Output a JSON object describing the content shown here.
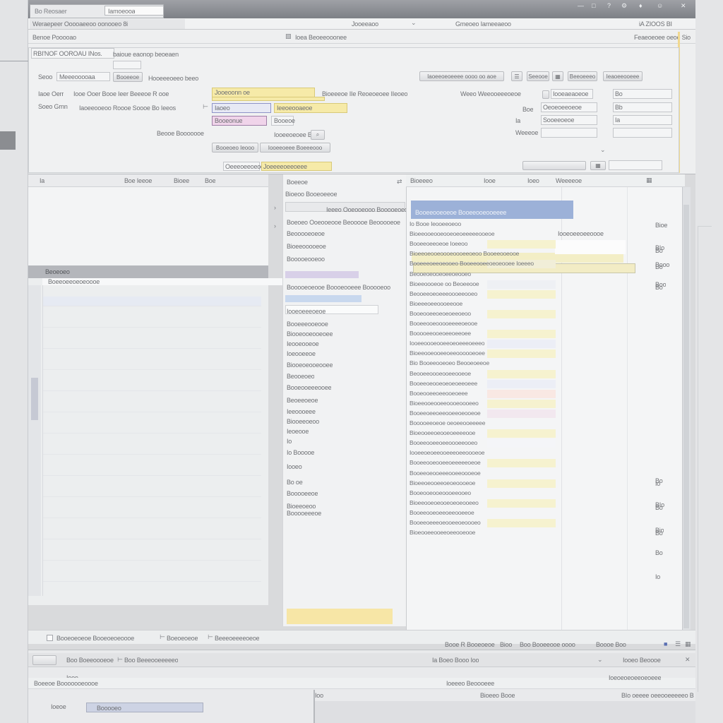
{
  "title": {
    "tab_label": "Bo Reosaer",
    "tab_selected": "Iamoeooa"
  },
  "menubar": {
    "path": "Weraepeer Ooooaeeoo oonooeo 8i",
    "center": "Jooeeaoo",
    "mid_right": "Gmeoeo Iameeaeoo",
    "icons": "iA ZIOOS BI"
  },
  "search": {
    "header_left": "Benoe Pooooao",
    "header_center": "Ioea Beoeeooonee",
    "header_right": "Feaeoeoee oeoe Sio",
    "subheader": "RBI'NOF OOROAU INos.",
    "subheader2": "baioue eaonop beoeaen",
    "row1_label": "Seoo",
    "row1_field": "Meeeooooaa",
    "row1_btn": "Booeeoe",
    "row1_text": "Hooeeeoeeo beeo",
    "row1_right": "Iaoeeoeoeeee oooo oo aoe",
    "row1_btn2": "Seeooe",
    "row1_btn3": "Beeoeeeo",
    "row1_btn4": "Ieaoeeooeee",
    "f1_label": "Iaoe Oerr",
    "f1_text": "Iooe Ooer Booe Ieer Beeeoe R ooe",
    "f1_value": "Jooeoonn oe",
    "f1_right": "Bioeeeoe IIe Reoeoeoee IIeoeo",
    "f1_right2": "Weeo Weeooeeeoeoe",
    "f2_label": "Soeo Grnn",
    "f2_text": "Iaoeeooeoo Roooe Soooe Bo Ieeos",
    "f2_value": "Iaoeo",
    "f2_value2": "Ieeoeooaeoe",
    "f2_right": "Booeeoeoe",
    "f3_value": "Booeonue",
    "f3_value2": "Booeoe",
    "f3_left": "Beooe Booooooe",
    "f4_text": "Iooeeoeoee Bio",
    "f4_btn": "Booeoeo Ieooo",
    "f5_btn": "Iooeeoeee Boeeeooo",
    "right_labels": [
      "Ia",
      "Boe",
      "Weeeoe"
    ],
    "right_values": [
      "Iooeaeaoeoe",
      "Oeoeoeeoeoe",
      "Sooeeoeoe"
    ],
    "right_badges": [
      "Bo",
      "Bb",
      "Ia"
    ],
    "footer_field": "Oeeeoeeoeooeo",
    "footer_field2": "Joeeeeoeeoeee"
  },
  "left_panel": {
    "header": [
      "Ia",
      "Boe Ieeoe",
      "Bioee",
      "Boe"
    ],
    "bar_label": "Beoeoeo",
    "row_label": "Boeeoeeoeoeoooe"
  },
  "mid_panel": {
    "header": "Bioeoo Booeoeeoe",
    "items": [
      "Ieeeo  Ooeooeooo Booooeoeoe Ia",
      "Boeoeo Ooeooeooe Beooooe Beooooeoe",
      "Beooooeoeoe",
      "Bioeeooooeoe",
      "Booooeooeoo",
      "Booooeoeooe  Boooeooeee  Booooeoo",
      "Iooeoeeeoeoe",
      "Booeeeooeooe",
      "Biooeooeooeoee",
      "Ieooeooeoe",
      "Ioeooeeoe",
      "Biooeoeooeooee",
      "Beooeoeo",
      "Booeooeeeooee",
      "Beoeeoeoe",
      "Ieeoooeee",
      "Biooeeoeoo",
      "Ieoeooe",
      "Io",
      "Io  Booooe",
      "Iooeo",
      "Bo oe",
      "Booooeeoe",
      "Bioeeoeoo",
      "Booooeeeoe"
    ]
  },
  "right_panel": {
    "header": [
      "Bioeeeo",
      "Iooe",
      "Ioeo",
      "Weeeeoe"
    ],
    "selected": "Booeeooeoeoe  Booeeooeooeeee",
    "rows": [
      "Io Booe Ieooeeoeoo",
      "Bioeeooeooeooeoeoeeeeeooeoe",
      "Booeeoeeoeoe  Ioeeoo",
      "Bioeeoeooeoooeoooeeoeoo Booeeooeooe",
      "Booeeeoeeoeooeo Booeeooeeoeoeooee Ioeeeo",
      "Beooeoeooeoeeoeooeo",
      "Bioeeoooeoe oo Beoeeooe",
      "Beooeeoeoeeeoooeeooeo",
      "Bioeeeoeeoooeeooe",
      "Booeooeeoeoeoeeoeoo",
      "Booeeooeooooeeeeoeooe",
      "Booooeeooeoeeoeeoee",
      "Iooeeoooeooeeoeoeeeoeeeo",
      "Bioeeooeooeeoeeoooooeoee",
      "Bio Booeeooeoeo Beooeoeeoe",
      "Beooeeoooeooeeooeoe",
      "Booeeoeooeoeoeoeeoeee",
      "Booeooeeoeeooeoeee",
      "Bioeeooeooeeoooeoooeeo",
      "Booeeoeeoeeooeeoeooeoe",
      "Booooeeoeoe oeoeeooeeeee",
      "Bioeooeeoeooeoeeeeooe",
      "Booeeooeeoeeoooeeooeo",
      "Iooeeoeoeeooeeeoeeoooeoe",
      "Booeeooeooeeoeeeeeoeoe",
      "Booeeoeooeeeooeeoooeoe",
      "Bioeeoeooeeoeoeoooeoe",
      "Booeooeooeoooeeooeo",
      "Bioeeooeoeooeoeoeooeeo",
      "Booeeooeoeeoeeooeeoe",
      "Booeeoeeeoeooeeoeoooeo",
      "Bioeooeeooeeoeeooeooe"
    ],
    "right_col": [
      "Iooeoeeoeeoooe",
      "Bo",
      "Bo",
      "Bo",
      "Io",
      "Bo",
      "Bo",
      "Io"
    ],
    "far_col": [
      "Bioe",
      "BIo",
      "Booo",
      "Boo",
      "Bo",
      "BIo",
      "Bio",
      "Bo"
    ]
  },
  "status": {
    "left": "Booeoeoeoe Booeoeoeoooe",
    "mid": "Boeoeoeoe",
    "mid2": "Beeeoeeeeoeoe",
    "right": "Booe R Booeoeoe",
    "right2": "Bioo",
    "right3": "Boo Booeeooe oooo",
    "right4": "Boooe Boo"
  },
  "bottom": {
    "toolbar_left": "Boo Boeeoooeoe",
    "toolbar_mid": "Boo Beeeooeeeeeo",
    "toolbar_right": "Ia Boeo Booo Ioo",
    "toolbar_far": "Iooeo Beoooe",
    "row1_left": "Iooo",
    "row1_label": "Boeeoe Booooooeoooe",
    "row1_right": "Ioeeeo Beoooeee",
    "row1_far": "Ioeoeoeoeeoeoeee",
    "row2_label": "Ioeoe",
    "row2_value": "Booooeo",
    "row2_mid": "Ioo",
    "row2_right": "Bioeeo Booe",
    "row2_far": "BIo oeeee oeeooeeeeeo B"
  }
}
